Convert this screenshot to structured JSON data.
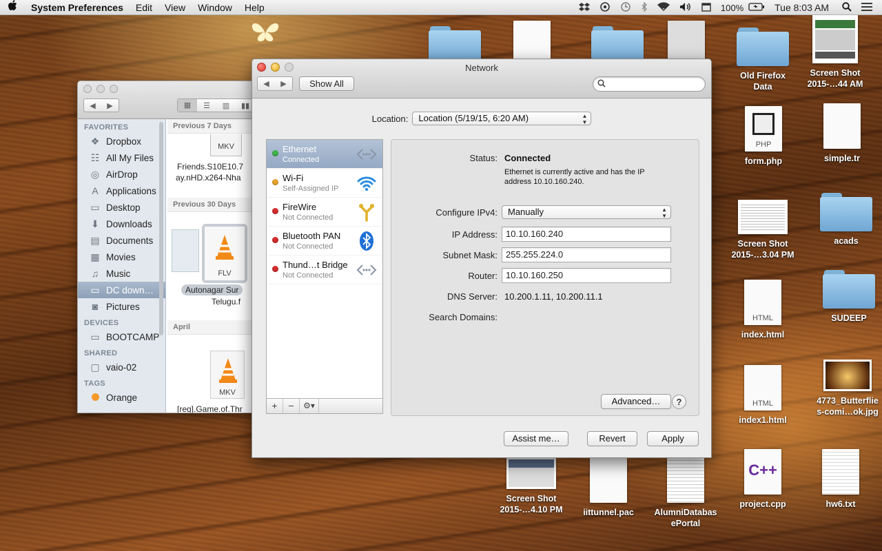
{
  "menubar": {
    "app": "System Preferences",
    "items": [
      "Edit",
      "View",
      "Window",
      "Help"
    ],
    "battery": "100%",
    "clock": "Tue 8:03 AM"
  },
  "desktop": {
    "icons": [
      {
        "label": "Old Firefox\nData",
        "kind": "folder"
      },
      {
        "label": "Screen Shot\n2015-…44 AM",
        "kind": "thumb"
      },
      {
        "label": "form.php",
        "kind": "doc",
        "tag": "PHP"
      },
      {
        "label": "simple.tr",
        "kind": "doc",
        "tag": ""
      },
      {
        "label": "Screen Shot\n2015-…3.04 PM",
        "kind": "thumb"
      },
      {
        "label": "acads",
        "kind": "folder"
      },
      {
        "label": "index.html",
        "kind": "doc",
        "tag": "HTML"
      },
      {
        "label": "SUDEEP",
        "kind": "folder"
      },
      {
        "label": "index1.html",
        "kind": "doc",
        "tag": "HTML"
      },
      {
        "label": "4773_Butterflie\ns-comi…ok.jpg",
        "kind": "thumb"
      },
      {
        "label": "Screen Shot\n2015-…4.10 PM",
        "kind": "thumb"
      },
      {
        "label": "iittunnel.pac",
        "kind": "doc",
        "tag": ""
      },
      {
        "label": "AlumniDatabas\nePortal",
        "kind": "doc",
        "tag": ""
      },
      {
        "label": "project.cpp",
        "kind": "doc",
        "tag": "C++"
      },
      {
        "label": "hw6.txt",
        "kind": "doc",
        "tag": ""
      }
    ]
  },
  "finder": {
    "favorites_header": "FAVORITES",
    "favorites": [
      {
        "label": "Dropbox",
        "icon": "dropbox-icon"
      },
      {
        "label": "All My Files",
        "icon": "all-files-icon"
      },
      {
        "label": "AirDrop",
        "icon": "airdrop-icon"
      },
      {
        "label": "Applications",
        "icon": "applications-icon"
      },
      {
        "label": "Desktop",
        "icon": "desktop-icon"
      },
      {
        "label": "Downloads",
        "icon": "downloads-icon"
      },
      {
        "label": "Documents",
        "icon": "documents-icon"
      },
      {
        "label": "Movies",
        "icon": "movies-icon"
      },
      {
        "label": "Music",
        "icon": "music-icon"
      },
      {
        "label": "DC down…",
        "icon": "folder-icon",
        "selected": true
      },
      {
        "label": "Pictures",
        "icon": "pictures-icon"
      }
    ],
    "devices_header": "DEVICES",
    "devices": [
      {
        "label": "BOOTCAMP",
        "icon": "drive-icon"
      }
    ],
    "shared_header": "SHARED",
    "shared": [
      {
        "label": "vaio-02",
        "icon": "computer-icon"
      }
    ],
    "tags_header": "TAGS",
    "tags": [
      {
        "label": "Orange",
        "color": "#f39a2b"
      }
    ],
    "sections": [
      {
        "title": "Previous 7 Days",
        "file_line1": "Friends.S10E10.7",
        "file_line2": "ay.nHD.x264-Nha",
        "badge": "MKV"
      },
      {
        "title": "Previous 30 Days",
        "file_line1": "Autonagar Sur",
        "file_line2": "Telugu.f",
        "badge": "FLV"
      },
      {
        "title": "April",
        "file_line1": "[reg].Game.of.Thr",
        "file_line2": "",
        "badge": "MKV"
      }
    ]
  },
  "network": {
    "title": "Network",
    "show_all": "Show All",
    "search_placeholder": "",
    "location_label": "Location:",
    "location_value": "Location (5/19/15, 6:20 AM)",
    "services": [
      {
        "name": "Ethernet",
        "status": "Connected",
        "dot": "#3fb54a",
        "icon": "ethernet-icon",
        "selected": true
      },
      {
        "name": "Wi-Fi",
        "status": "Self-Assigned IP",
        "dot": "#e8a62a",
        "icon": "wifi-icon"
      },
      {
        "name": "FireWire",
        "status": "Not Connected",
        "dot": "#d62d2d",
        "icon": "firewire-icon"
      },
      {
        "name": "Bluetooth PAN",
        "status": "Not Connected",
        "dot": "#d62d2d",
        "icon": "bluetooth-icon"
      },
      {
        "name": "Thund…t Bridge",
        "status": "Not Connected",
        "dot": "#d62d2d",
        "icon": "thunderbolt-bridge-icon"
      }
    ],
    "list_buttons": {
      "add": "+",
      "remove": "−",
      "gear": "⚙▾"
    },
    "status_label": "Status:",
    "status_value": "Connected",
    "status_desc_1": "Ethernet is currently active and has the IP",
    "status_desc_2": "address 10.10.160.240.",
    "configure_label": "Configure IPv4:",
    "configure_value": "Manually",
    "ip_label": "IP Address:",
    "ip_value": "10.10.160.240",
    "subnet_label": "Subnet Mask:",
    "subnet_value": "255.255.224.0",
    "router_label": "Router:",
    "router_value": "10.10.160.250",
    "dns_label": "DNS Server:",
    "dns_value": "10.200.1.11, 10.200.11.1",
    "search_domains_label": "Search Domains:",
    "advanced_button": "Advanced…",
    "help_button": "?",
    "assist_button": "Assist me…",
    "revert_button": "Revert",
    "apply_button": "Apply"
  }
}
